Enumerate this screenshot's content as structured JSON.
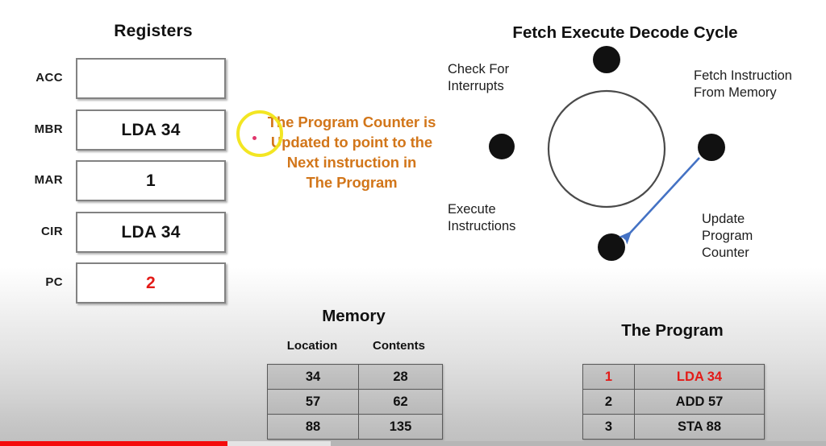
{
  "registers": {
    "title": "Registers",
    "rows": [
      {
        "label": "ACC",
        "value": "",
        "highlight": false
      },
      {
        "label": "MBR",
        "value": "LDA 34",
        "highlight": false
      },
      {
        "label": "MAR",
        "value": "1",
        "highlight": false
      },
      {
        "label": "CIR",
        "value": "LDA 34",
        "highlight": false
      },
      {
        "label": "PC",
        "value": "2",
        "highlight": true
      }
    ]
  },
  "annotation": {
    "text": "The Program Counter is Updated to point to the Next instruction in The Program",
    "line1": "The Program Counter is",
    "line2": "Updated to point to the",
    "line3": "Next instruction in",
    "line4": "The Program",
    "color": "#d2761a",
    "circle_color": "#f2e517",
    "dot_color": "#e0366c"
  },
  "cycle": {
    "title": "Fetch Execute Decode Cycle",
    "labels": {
      "top_left": "Check For\nInterrupts",
      "top_right": "Fetch Instruction\nFrom Memory",
      "bottom_left": "Execute\nInstructions",
      "bottom_right": "Update\nProgram\nCounter"
    },
    "arrow_color": "#4472c4",
    "node_color": "#111111"
  },
  "memory": {
    "title": "Memory",
    "headers": [
      "Location",
      "Contents"
    ],
    "rows": [
      {
        "location": "34",
        "contents": "28"
      },
      {
        "location": "57",
        "contents": "62"
      },
      {
        "location": "88",
        "contents": "135"
      }
    ]
  },
  "program": {
    "title": "The Program",
    "rows": [
      {
        "line": "1",
        "instruction": "LDA 34",
        "highlight": true
      },
      {
        "line": "2",
        "instruction": "ADD 57",
        "highlight": false
      },
      {
        "line": "3",
        "instruction": "STA  88",
        "highlight": false
      }
    ]
  },
  "player": {
    "progress_color": "#f40c0c",
    "buffered_color": "#e4e4e4",
    "track_color": "#b6b6b6"
  }
}
